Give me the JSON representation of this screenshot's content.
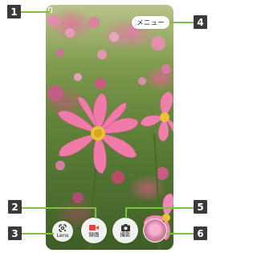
{
  "callouts": [
    "1",
    "2",
    "3",
    "4",
    "5",
    "6"
  ],
  "camera": {
    "menu_label": "メニュー",
    "lens_label": "Lens",
    "video_label": "録画",
    "photo_label": "撮影",
    "record_color": "#e8403a",
    "callout_line_color": "#7bc142",
    "badge_color": "#3a3a3a"
  },
  "icons": {
    "status": "battery-status-icon",
    "lens": "google-lens-icon",
    "video": "video-camera-icon",
    "photo": "camera-icon",
    "thumbnail": "last-photo-thumbnail"
  }
}
